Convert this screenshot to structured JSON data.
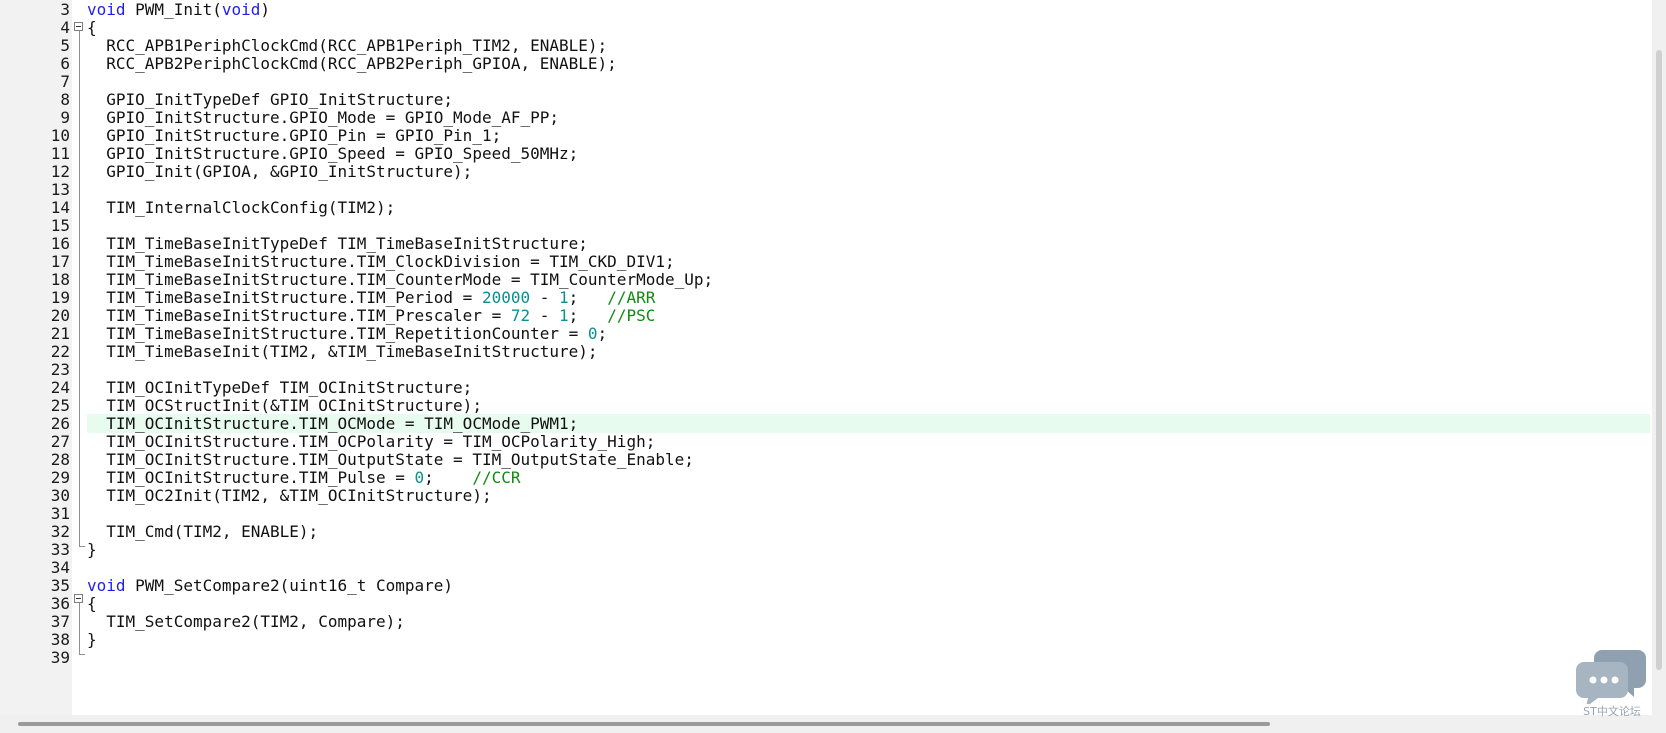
{
  "editor": {
    "current_line": 26,
    "lines": [
      {
        "n": "3",
        "tokens": [
          {
            "t": "void",
            "c": "kw"
          },
          {
            "t": " PWM_Init("
          },
          {
            "t": "void",
            "c": "kw"
          },
          {
            "t": ")"
          }
        ]
      },
      {
        "n": "4",
        "tokens": [
          {
            "t": "{"
          }
        ]
      },
      {
        "n": "5",
        "tokens": [
          {
            "t": "  RCC_APB1PeriphClockCmd(RCC_APB1Periph_TIM2, ENABLE);"
          }
        ]
      },
      {
        "n": "6",
        "tokens": [
          {
            "t": "  RCC_APB2PeriphClockCmd(RCC_APB2Periph_GPIOA, ENABLE);"
          }
        ]
      },
      {
        "n": "7",
        "tokens": []
      },
      {
        "n": "8",
        "tokens": [
          {
            "t": "  GPIO_InitTypeDef GPIO_InitStructure;"
          }
        ]
      },
      {
        "n": "9",
        "tokens": [
          {
            "t": "  GPIO_InitStructure.GPIO_Mode = GPIO_Mode_AF_PP;"
          }
        ]
      },
      {
        "n": "10",
        "tokens": [
          {
            "t": "  GPIO_InitStructure.GPIO_Pin = GPIO_Pin_1;"
          }
        ]
      },
      {
        "n": "11",
        "tokens": [
          {
            "t": "  GPIO_InitStructure.GPIO_Speed = GPIO_Speed_50MHz;"
          }
        ]
      },
      {
        "n": "12",
        "tokens": [
          {
            "t": "  GPIO_Init(GPIOA, &GPIO_InitStructure);"
          }
        ]
      },
      {
        "n": "13",
        "tokens": []
      },
      {
        "n": "14",
        "tokens": [
          {
            "t": "  TIM_InternalClockConfig(TIM2);"
          }
        ]
      },
      {
        "n": "15",
        "tokens": []
      },
      {
        "n": "16",
        "tokens": [
          {
            "t": "  TIM_TimeBaseInitTypeDef TIM_TimeBaseInitStructure;"
          }
        ]
      },
      {
        "n": "17",
        "tokens": [
          {
            "t": "  TIM_TimeBaseInitStructure.TIM_ClockDivision = TIM_CKD_DIV1;"
          }
        ]
      },
      {
        "n": "18",
        "tokens": [
          {
            "t": "  TIM_TimeBaseInitStructure.TIM_CounterMode = TIM_CounterMode_Up;"
          }
        ]
      },
      {
        "n": "19",
        "tokens": [
          {
            "t": "  TIM_TimeBaseInitStructure.TIM_Period = "
          },
          {
            "t": "20000",
            "c": "num"
          },
          {
            "t": " - "
          },
          {
            "t": "1",
            "c": "num"
          },
          {
            "t": ";   "
          },
          {
            "t": "//ARR",
            "c": "cm"
          }
        ]
      },
      {
        "n": "20",
        "tokens": [
          {
            "t": "  TIM_TimeBaseInitStructure.TIM_Prescaler = "
          },
          {
            "t": "72",
            "c": "num"
          },
          {
            "t": " - "
          },
          {
            "t": "1",
            "c": "num"
          },
          {
            "t": ";   "
          },
          {
            "t": "//PSC",
            "c": "cm"
          }
        ]
      },
      {
        "n": "21",
        "tokens": [
          {
            "t": "  TIM_TimeBaseInitStructure.TIM_RepetitionCounter = "
          },
          {
            "t": "0",
            "c": "num"
          },
          {
            "t": ";"
          }
        ]
      },
      {
        "n": "22",
        "tokens": [
          {
            "t": "  TIM_TimeBaseInit(TIM2, &TIM_TimeBaseInitStructure);"
          }
        ]
      },
      {
        "n": "23",
        "tokens": []
      },
      {
        "n": "24",
        "tokens": [
          {
            "t": "  TIM_OCInitTypeDef TIM_OCInitStructure;"
          }
        ]
      },
      {
        "n": "25",
        "tokens": [
          {
            "t": "  TIM_OCStructInit(&TIM_OCInitStructure);"
          }
        ]
      },
      {
        "n": "26",
        "tokens": [
          {
            "t": "  TIM_OCInitStructure.TIM_OCMode = TIM_OCMode_PWM1;"
          }
        ]
      },
      {
        "n": "27",
        "tokens": [
          {
            "t": "  TIM_OCInitStructure.TIM_OCPolarity = TIM_OCPolarity_High;"
          }
        ]
      },
      {
        "n": "28",
        "tokens": [
          {
            "t": "  TIM_OCInitStructure.TIM_OutputState = TIM_OutputState_Enable;"
          }
        ]
      },
      {
        "n": "29",
        "tokens": [
          {
            "t": "  TIM_OCInitStructure.TIM_Pulse = "
          },
          {
            "t": "0",
            "c": "num"
          },
          {
            "t": ";    "
          },
          {
            "t": "//CCR",
            "c": "cm"
          }
        ]
      },
      {
        "n": "30",
        "tokens": [
          {
            "t": "  TIM_OC2Init(TIM2, &TIM_OCInitStructure);"
          }
        ]
      },
      {
        "n": "31",
        "tokens": []
      },
      {
        "n": "32",
        "tokens": [
          {
            "t": "  TIM_Cmd(TIM2, ENABLE);"
          }
        ]
      },
      {
        "n": "33",
        "tokens": [
          {
            "t": "}"
          }
        ]
      },
      {
        "n": "34",
        "tokens": []
      },
      {
        "n": "35",
        "tokens": [
          {
            "t": "void",
            "c": "kw"
          },
          {
            "t": " PWM_SetCompare2(uint16_t Compare)"
          }
        ]
      },
      {
        "n": "36",
        "tokens": [
          {
            "t": "{"
          }
        ]
      },
      {
        "n": "37",
        "tokens": [
          {
            "t": "  TIM_SetCompare2(TIM2, Compare);"
          }
        ]
      },
      {
        "n": "38",
        "tokens": [
          {
            "t": "}"
          }
        ]
      },
      {
        "n": "39",
        "tokens": []
      }
    ]
  },
  "colors": {
    "keyword": "#1e1ef0",
    "number": "#0a8f8f",
    "comment": "#128a12",
    "current_line_bg": "#e8fbef",
    "gutter_bg": "#f2f2f2"
  },
  "watermark": {
    "icon": "chat-bubbles-icon",
    "text": "ST中文论坛"
  }
}
